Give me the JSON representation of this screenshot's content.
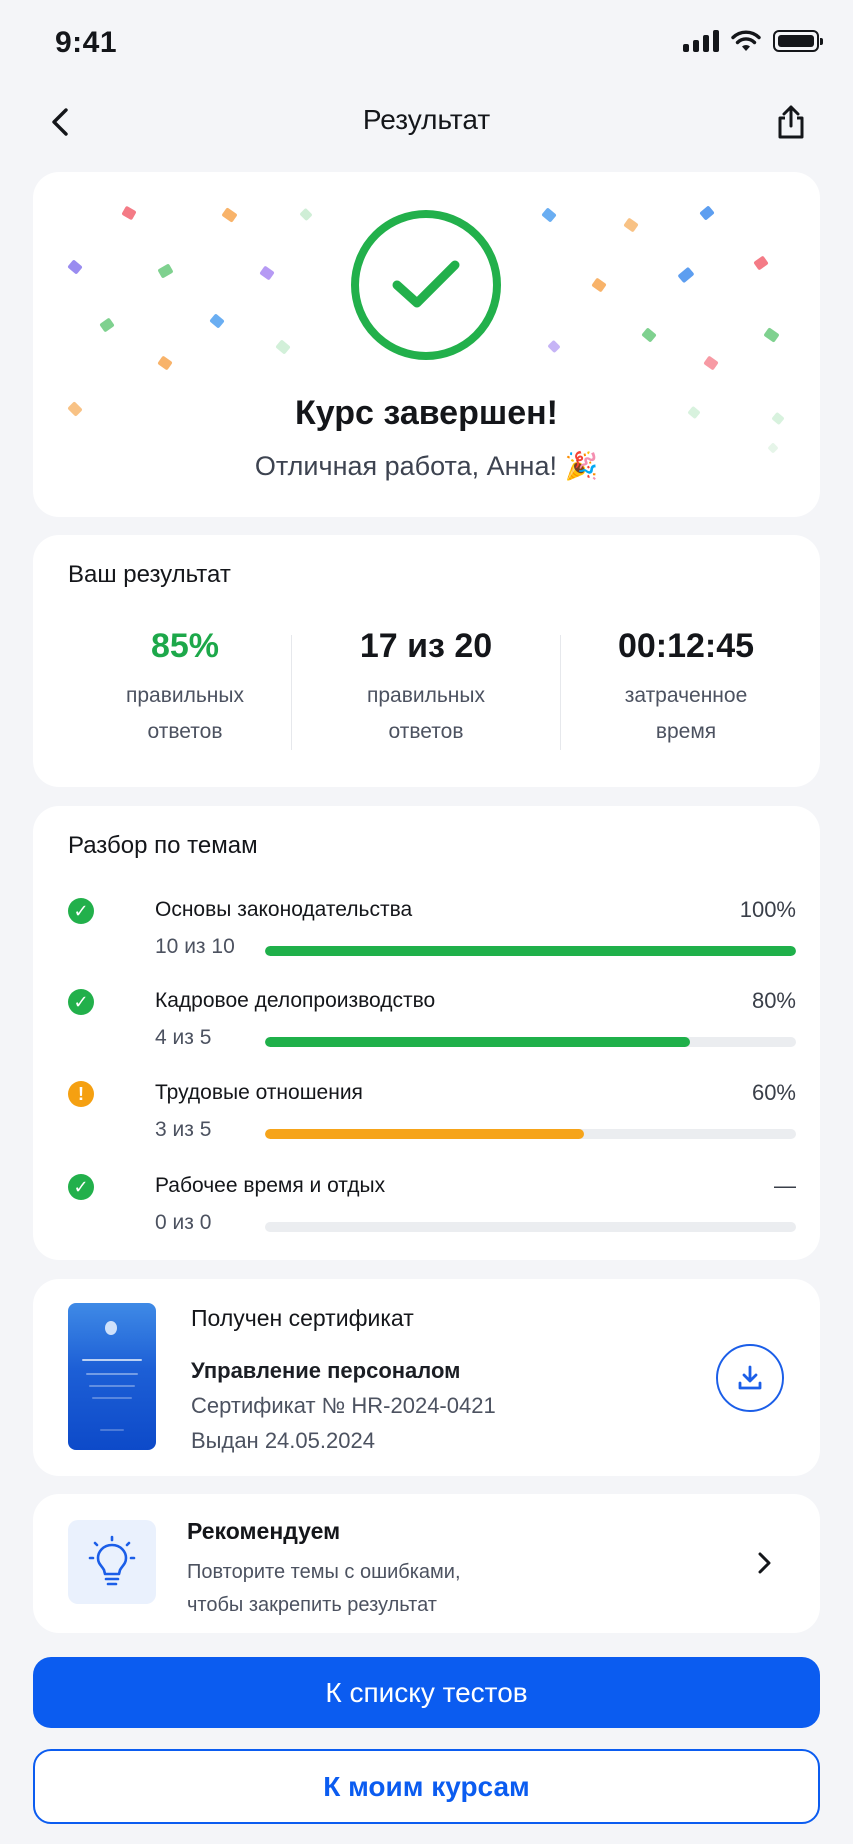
{
  "status_bar": {
    "time": "9:41"
  },
  "nav": {
    "title": "Результат"
  },
  "hero": {
    "title": "Курс завершен!",
    "subtitle": "Отличная работа, Анна! 🎉",
    "accent_color": "#22b04b"
  },
  "result": {
    "title": "Ваш результат",
    "stats": [
      {
        "value": "85%",
        "label_line1": "правильных",
        "label_line2": "ответов"
      },
      {
        "value": "17 из 20",
        "label_line1": "правильных",
        "label_line2": "ответов"
      },
      {
        "value": "00:12:45",
        "label_line1": "затраченное",
        "label_line2": "время"
      }
    ]
  },
  "topics": {
    "title": "Разбор по темам",
    "items": [
      {
        "name": "Основы законодательства",
        "count": "10 из 10",
        "percent_label": "100%",
        "progress": 1.0,
        "status": "ok"
      },
      {
        "name": "Кадровое делопроизводство",
        "count": "4 из 5",
        "percent_label": "80%",
        "progress": 0.8,
        "status": "ok"
      },
      {
        "name": "Трудовые отношения",
        "count": "3 из 5",
        "percent_label": "60%",
        "progress": 0.6,
        "status": "warn"
      },
      {
        "name": "Рабочее время и отдых",
        "count": "0 из 0",
        "percent_label": "—",
        "progress": 0,
        "status": "ok"
      }
    ],
    "status_symbols": {
      "ok": "✓",
      "warn": "!"
    }
  },
  "certificate": {
    "heading": "Получен сертификат",
    "name": "Управление персоналом",
    "number": "Сертификат № HR-2024-0421",
    "issued": "Выдан 24.05.2024"
  },
  "recommendation": {
    "title": "Рекомендуем",
    "text": "Повторите темы с ошибками, чтобы закрепить результат"
  },
  "buttons": {
    "primary": "К списку тестов",
    "secondary": "К моим курсам"
  },
  "colors": {
    "primary": "#0b5cf0",
    "success": "#22b04b",
    "warning": "#f5a011"
  }
}
